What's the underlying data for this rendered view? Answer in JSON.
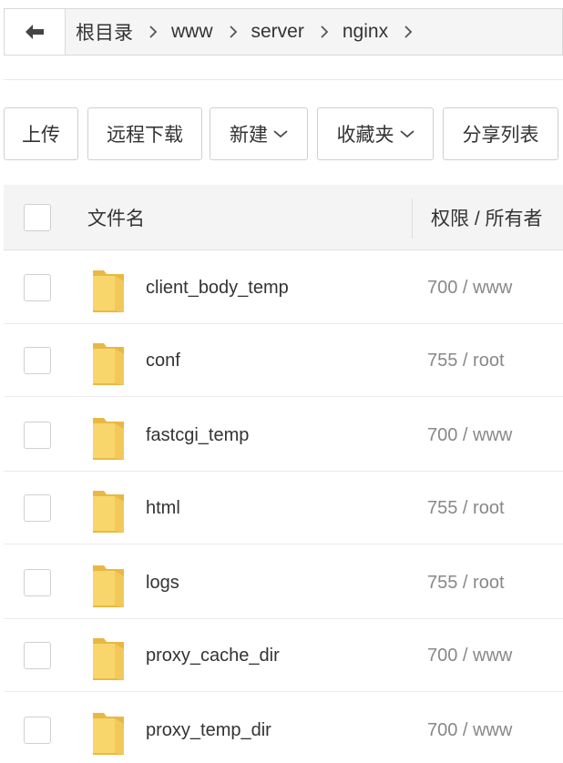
{
  "path": {
    "back_icon": "arrow-left-icon",
    "crumbs": [
      "根目录",
      "www",
      "server",
      "nginx"
    ]
  },
  "toolbar": {
    "upload": "上传",
    "remote_download": "远程下载",
    "new": "新建",
    "favorites": "收藏夹",
    "share_list": "分享列表"
  },
  "table": {
    "headers": {
      "name": "文件名",
      "perm_owner": "权限 / 所有者"
    },
    "rows": [
      {
        "name": "client_body_temp",
        "perm": "700 / www"
      },
      {
        "name": "conf",
        "perm": "755 / root"
      },
      {
        "name": "fastcgi_temp",
        "perm": "700 / www"
      },
      {
        "name": "html",
        "perm": "755 / root"
      },
      {
        "name": "logs",
        "perm": "755 / root"
      },
      {
        "name": "proxy_cache_dir",
        "perm": "700 / www"
      },
      {
        "name": "proxy_temp_dir",
        "perm": "700 / www"
      }
    ]
  },
  "colors": {
    "folder": "#f9d66b",
    "folder_dark": "#e8b942",
    "border": "#d9d9d9"
  }
}
